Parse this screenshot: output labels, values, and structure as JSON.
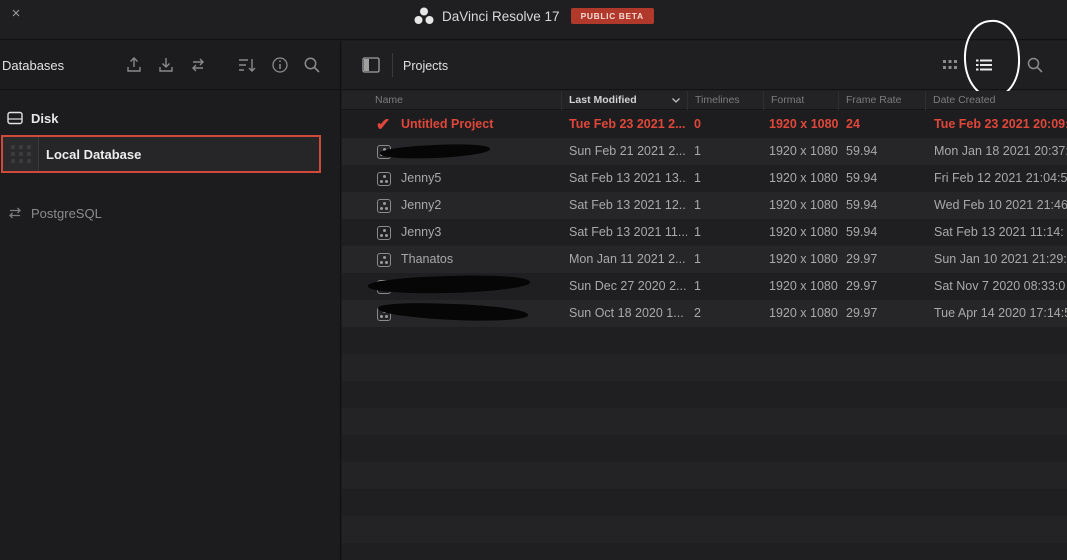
{
  "window": {
    "close_label": "×",
    "title": "DaVinci Resolve 17",
    "badge": "PUBLIC BETA",
    "accent_color": "#b0392b"
  },
  "databases_panel": {
    "title": "Databases",
    "toolbar_icons": [
      "upload-icon",
      "download-icon",
      "switch-icon",
      "sort-icon",
      "info-icon",
      "search-icon"
    ],
    "disk_label": "Disk",
    "selected_database": "Local Database",
    "postgres_label": "PostgreSQL",
    "selection_color": "#d04a3a"
  },
  "projects_panel": {
    "title": "Projects",
    "view_icons": [
      "grid-view-icon",
      "list-view-icon",
      "search-icon"
    ],
    "columns": [
      "Name",
      "Last Modified",
      "Timelines",
      "Format",
      "Frame Rate",
      "Date Created"
    ],
    "sorted_column": "Last Modified",
    "rows": [
      {
        "name": "Untitled Project",
        "modified": "Tue Feb 23 2021 2...",
        "timelines": "0",
        "format": "1920 x 1080",
        "fps": "24",
        "created": "Tue Feb 23 2021 20:09:",
        "selected": true
      },
      {
        "name": "",
        "modified": "Sun Feb 21 2021 2...",
        "timelines": "1",
        "format": "1920 x 1080",
        "fps": "59.94",
        "created": "Mon Jan 18 2021 20:37:",
        "redacted": true
      },
      {
        "name": "Jenny5",
        "modified": "Sat Feb 13 2021 13...",
        "timelines": "1",
        "format": "1920 x 1080",
        "fps": "59.94",
        "created": "Fri Feb 12 2021 21:04:5"
      },
      {
        "name": "Jenny2",
        "modified": "Sat Feb 13 2021 12...",
        "timelines": "1",
        "format": "1920 x 1080",
        "fps": "59.94",
        "created": "Wed Feb 10 2021 21:46"
      },
      {
        "name": "Jenny3",
        "modified": "Sat Feb 13 2021 11...",
        "timelines": "1",
        "format": "1920 x 1080",
        "fps": "59.94",
        "created": "Sat Feb 13 2021 11:14:"
      },
      {
        "name": "Thanatos",
        "modified": "Mon Jan 11 2021 2...",
        "timelines": "1",
        "format": "1920 x 1080",
        "fps": "29.97",
        "created": "Sun Jan 10 2021 21:29:3"
      },
      {
        "name": "",
        "modified": "Sun Dec 27 2020 2...",
        "timelines": "1",
        "format": "1920 x 1080",
        "fps": "29.97",
        "created": "Sat Nov 7 2020 08:33:0",
        "redacted": true
      },
      {
        "name": "",
        "modified": "Sun Oct 18 2020 1...",
        "timelines": "2",
        "format": "1920 x 1080",
        "fps": "29.97",
        "created": "Tue Apr 14 2020 17:14:5",
        "redacted": true
      }
    ],
    "highlight_color": "#e0473a"
  }
}
